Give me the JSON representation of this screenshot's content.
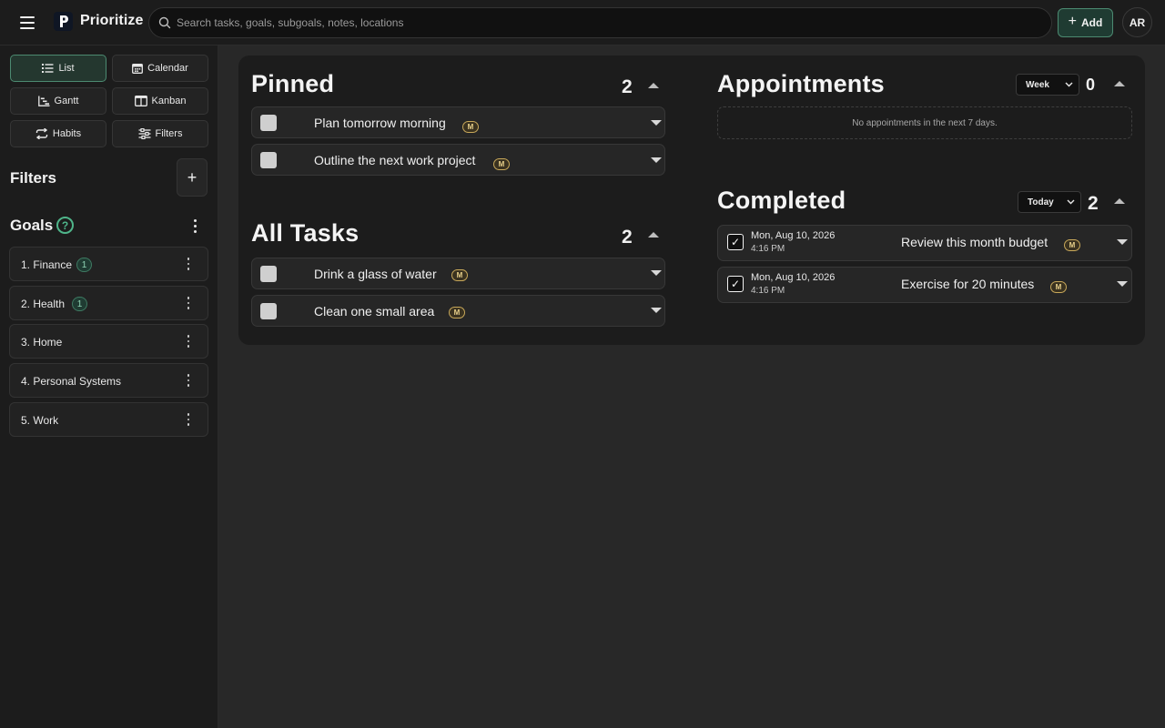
{
  "app": {
    "title": "Prioritize",
    "logo_letter": "P"
  },
  "search": {
    "placeholder": "Search tasks, goals, subgoals, notes, locations",
    "value": ""
  },
  "header": {
    "add_label": "Add",
    "avatar_initials": "AR"
  },
  "views": [
    {
      "label": "List",
      "icon": "list-icon",
      "active": true
    },
    {
      "label": "Calendar",
      "icon": "calendar-icon",
      "active": false
    },
    {
      "label": "Gantt",
      "icon": "gantt-icon",
      "active": false
    },
    {
      "label": "Kanban",
      "icon": "kanban-icon",
      "active": false
    },
    {
      "label": "Habits",
      "icon": "repeat-icon",
      "active": false
    },
    {
      "label": "Filters",
      "icon": "sliders-icon",
      "active": false
    }
  ],
  "sidebar": {
    "filters_title": "Filters",
    "filters_add": "+",
    "goals_title": "Goals",
    "goals_help": "?",
    "goals": [
      {
        "label": "1. Finance",
        "badge": "1"
      },
      {
        "label": "2. Health",
        "badge": "1"
      },
      {
        "label": "3. Home",
        "badge": null
      },
      {
        "label": "4. Personal Systems",
        "badge": null
      },
      {
        "label": "5. Work",
        "badge": null
      }
    ]
  },
  "pinned": {
    "title": "Pinned",
    "count": "2",
    "tasks": [
      {
        "title": "Plan tomorrow morning",
        "badge": "M"
      },
      {
        "title": "Outline the next work project",
        "badge": "M"
      }
    ]
  },
  "all_tasks": {
    "title": "All Tasks",
    "count": "2",
    "tasks": [
      {
        "title": "Drink a glass of water",
        "badge": "M"
      },
      {
        "title": "Clean one small area",
        "badge": "M"
      }
    ]
  },
  "appointments": {
    "title": "Appointments",
    "range": "Week",
    "count": "0",
    "empty_text": "No appointments in the next 7 days."
  },
  "completed": {
    "title": "Completed",
    "range": "Today",
    "count": "2",
    "tasks": [
      {
        "date": "Mon, Aug 10, 2026",
        "time": "4:16 PM",
        "title": "Review this month budget",
        "badge": "M",
        "check": "✓"
      },
      {
        "date": "Mon, Aug 10, 2026",
        "time": "4:16 PM",
        "title": "Exercise for 20 minutes",
        "badge": "M",
        "check": "✓"
      }
    ]
  },
  "colors": {
    "accent_green": "#4c8a71",
    "badge_gold": "#c8a85a",
    "panel_bg": "#1c1c1c",
    "page_bg": "#282828"
  }
}
